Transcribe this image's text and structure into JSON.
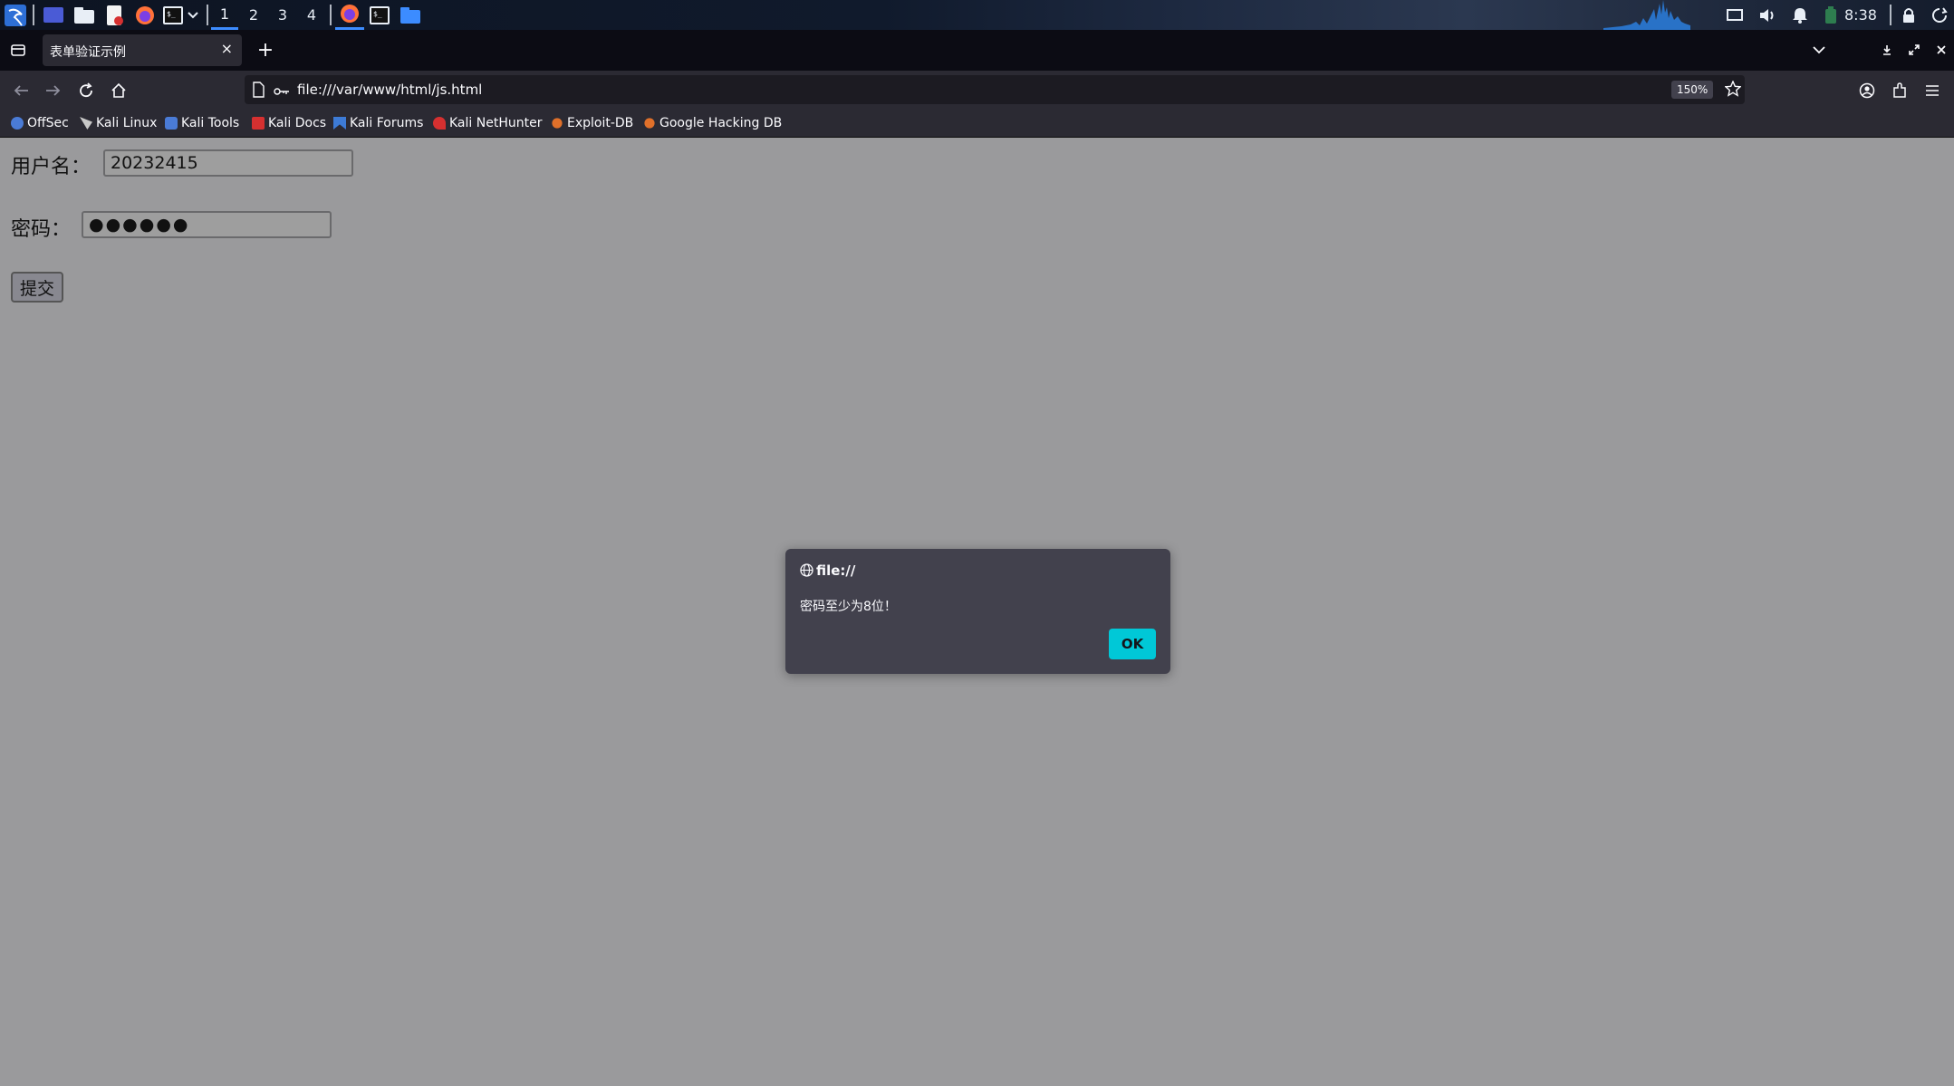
{
  "panel": {
    "workspaces": [
      "1",
      "2",
      "3",
      "4"
    ],
    "active_workspace": "1",
    "clock": "8:38",
    "icons": [
      "kali-menu-icon",
      "desktop-icon",
      "file-manager-icon",
      "text-editor-icon",
      "firefox-icon",
      "terminal-icon",
      "chevron-down-icon",
      "firefox-task-icon",
      "terminal-task-icon",
      "folder-task-icon",
      "display-icon",
      "volume-icon",
      "notification-bell-icon",
      "battery-icon",
      "lock-icon",
      "power-icon"
    ]
  },
  "tabs": [
    {
      "title": "表单验证示例",
      "close": "×"
    }
  ],
  "new_tab": "+",
  "navbar": {
    "url": "file:///var/www/html/js.html",
    "zoom": "150%"
  },
  "bookmarks": [
    {
      "label": "OffSec",
      "color": "#4a7bd6"
    },
    {
      "label": "Kali Linux",
      "color": "#c8c8c8"
    },
    {
      "label": "Kali Tools",
      "color": "#4a7bd6"
    },
    {
      "label": "Kali Docs",
      "color": "#d63030"
    },
    {
      "label": "Kali Forums",
      "color": "#3d7bd6"
    },
    {
      "label": "Kali NetHunter",
      "color": "#d63030"
    },
    {
      "label": "Exploit-DB",
      "color": "#e0702a"
    },
    {
      "label": "Google Hacking DB",
      "color": "#e0702a"
    }
  ],
  "form": {
    "username_label": "用户名：",
    "username_value": "20232415",
    "password_label": "密码：",
    "password_value": "●●●●●●",
    "submit_label": "提交"
  },
  "dialog": {
    "origin": "file://",
    "message": "密码至少为8位！",
    "ok_label": "OK"
  },
  "colors": {
    "dialog_ok": "#00c8d7",
    "tab_bg": "#2b2a33",
    "page_bg": "#9a9a9c"
  }
}
